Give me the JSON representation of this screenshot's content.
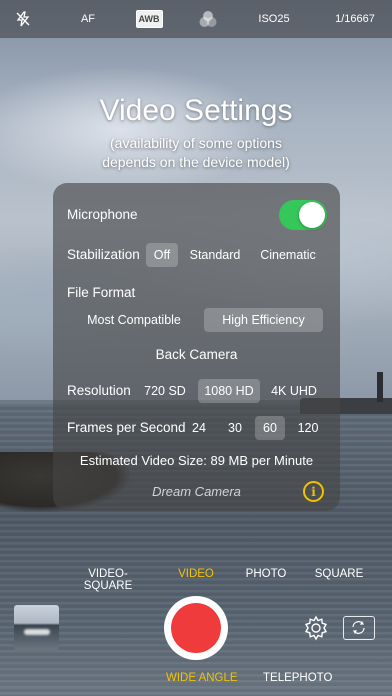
{
  "topbar": {
    "af": "AF",
    "awb": "AWB",
    "iso": "ISO25",
    "shutter": "1/16667"
  },
  "heading": {
    "title": "Video Settings",
    "subtitle_line1": "(availability of some options",
    "subtitle_line2": "depends on the device model)"
  },
  "settings": {
    "microphone": {
      "label": "Microphone",
      "enabled": true
    },
    "stabilization": {
      "label": "Stabilization",
      "options": [
        "Off",
        "Standard",
        "Cinematic"
      ],
      "selected": "Off"
    },
    "file_format": {
      "label": "File Format",
      "options": [
        "Most Compatible",
        "High Efficiency"
      ],
      "selected": "High Efficiency"
    },
    "section_back_camera": "Back Camera",
    "resolution": {
      "label": "Resolution",
      "options": [
        "720 SD",
        "1080 HD",
        "4K UHD"
      ],
      "selected": "1080 HD"
    },
    "fps": {
      "label": "Frames per Second",
      "options": [
        "24",
        "30",
        "60",
        "120"
      ],
      "selected": "60"
    },
    "estimated_size": "Estimated Video Size: 89 MB per Minute",
    "brand": "Dream Camera",
    "info_glyph": "i"
  },
  "modes": {
    "items": [
      "VIDEO-SQUARE",
      "VIDEO",
      "PHOTO",
      "SQUARE"
    ],
    "active": "VIDEO"
  },
  "lenses": {
    "items": [
      "WIDE ANGLE",
      "TELEPHOTO"
    ],
    "active": "WIDE ANGLE"
  },
  "colors": {
    "accent_yellow": "#f2c200",
    "toggle_green": "#35c759",
    "shutter_red": "#ef3b3b"
  },
  "icons": {
    "flash": "flash-off-icon",
    "filters": "color-filters-icon",
    "settings": "gear-icon",
    "flip": "switch-camera-icon"
  }
}
